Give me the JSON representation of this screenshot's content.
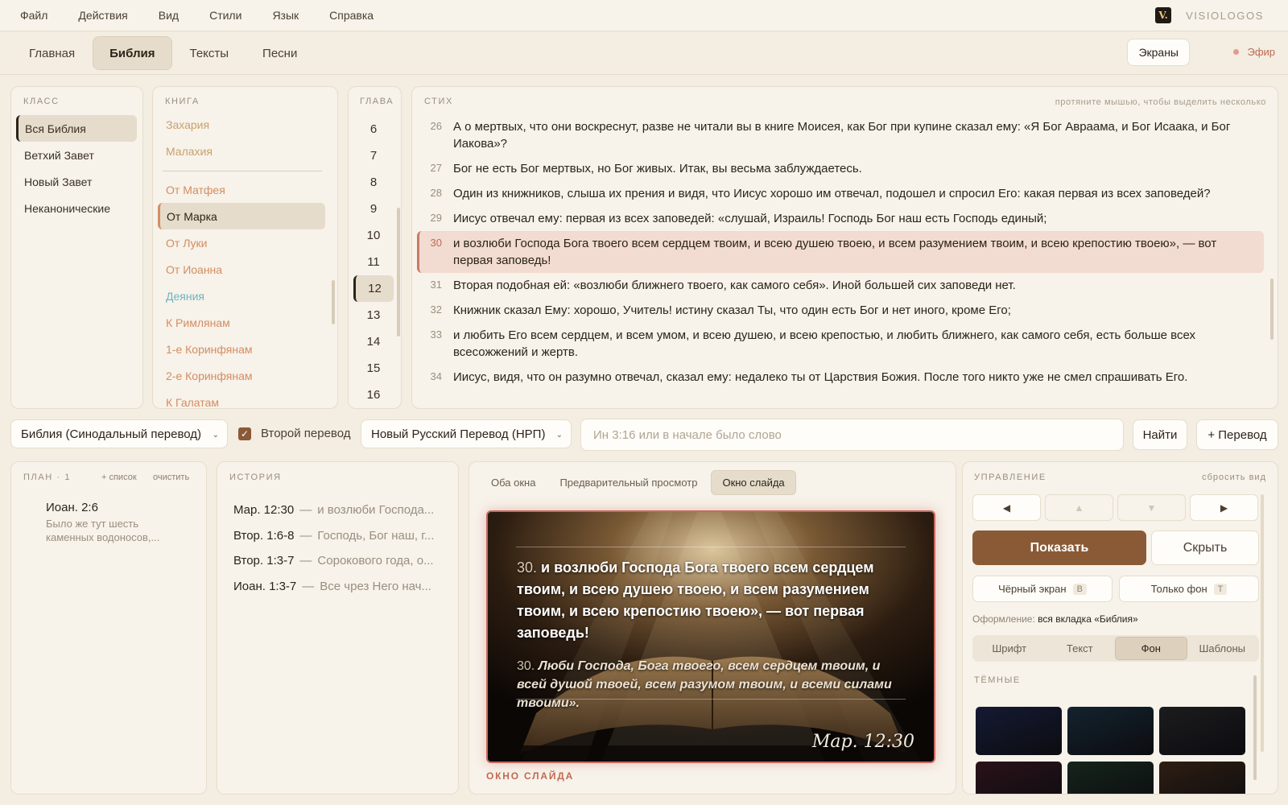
{
  "menu": [
    "Файл",
    "Действия",
    "Вид",
    "Стили",
    "Язык",
    "Справка"
  ],
  "brand": {
    "logo": "V.",
    "name": "VISIOLOGOS"
  },
  "tabs": [
    "Главная",
    "Библия",
    "Тексты",
    "Песни"
  ],
  "active_tab": "Библия",
  "screens_label": "Экраны",
  "air_label": "Эфир",
  "class_panel": {
    "label": "КЛАСС",
    "items": [
      "Вся Библия",
      "Ветхий Завет",
      "Новый Завет",
      "Неканонические"
    ],
    "active": "Вся Библия"
  },
  "book_panel": {
    "label": "КНИГА",
    "ot_items": [
      "Захария",
      "Малахия"
    ],
    "nt_items": [
      "От Матфея",
      "От Марка",
      "От Луки",
      "От Иоанна",
      "Деяния",
      "К Римлянам",
      "1-е Коринфянам",
      "2-е Коринфянам",
      "К Галатам"
    ],
    "active": "От Марка"
  },
  "chapter_panel": {
    "label": "ГЛАВА",
    "items": [
      "6",
      "7",
      "8",
      "9",
      "10",
      "11",
      "12",
      "13",
      "14",
      "15",
      "16"
    ],
    "active": "12"
  },
  "verse_panel": {
    "label": "СТИХ",
    "hint": "протяните мышью, чтобы выделить несколько",
    "verses": [
      {
        "num": "26",
        "text": "А о мертвых, что они воскреснут, разве не читали вы в книге Моисея, как Бог при купине сказал ему: «Я Бог Авраама, и Бог Исаака, и Бог Иакова»?"
      },
      {
        "num": "27",
        "text": "Бог не есть Бог мертвых, но Бог живых. Итак, вы весьма заблуждаетесь."
      },
      {
        "num": "28",
        "text": "Один из книжников, слыша их прения и видя, что Иисус хорошо им отвечал, подошел и спросил Его: какая первая из всех заповедей?"
      },
      {
        "num": "29",
        "text": "Иисус отвечал ему: первая из всех заповедей: «слушай, Израиль! Господь Бог наш есть Господь единый;"
      },
      {
        "num": "30",
        "text": "и возлюби Господа Бога твоего всем сердцем твоим, и всею душею твоею, и всем разумением твоим, и всею крепостию твоею», — вот первая заповедь!"
      },
      {
        "num": "31",
        "text": "Вторая подобная ей: «возлюби ближнего твоего, как самого себя». Иной большей сих заповеди нет."
      },
      {
        "num": "32",
        "text": "Книжник сказал Ему: хорошо, Учитель! истину сказал Ты, что один есть Бог и нет иного, кроме Его;"
      },
      {
        "num": "33",
        "text": "и любить Его всем сердцем, и всем умом, и всею душею, и всею крепостью, и любить ближнего, как самого себя, есть больше всех всесожжений и жертв."
      },
      {
        "num": "34",
        "text": "Иисус, видя, что он разумно отвечал, сказал ему: недалеко ты от Царствия Божия. После того никто уже не смел спрашивать Его."
      }
    ],
    "active": "30"
  },
  "search": {
    "translation": "Библия (Синодальный перевод)",
    "second_checkbox_label": "Второй перевод",
    "second_checked": true,
    "second_translation": "Новый Русский Перевод (НРП)",
    "placeholder": "Ин 3:16 или в начале было слово",
    "find_label": "Найти",
    "add_translation_label": "+ Перевод"
  },
  "plan": {
    "label": "ПЛАН · 1",
    "add_list": "+ список",
    "clear": "очистить",
    "items": [
      {
        "ref": "Иоан. 2:6",
        "snippet": "Было же тут шесть каменных водоносов,..."
      }
    ]
  },
  "history": {
    "label": "ИСТОРИЯ",
    "items": [
      {
        "ref": "Мар. 12:30",
        "text": "и возлюби Господа..."
      },
      {
        "ref": "Втор. 1:6-8",
        "text": "Господь, Бог наш, г..."
      },
      {
        "ref": "Втор. 1:3-7",
        "text": "Сорокового года, о..."
      },
      {
        "ref": "Иоан. 1:3-7",
        "text": "Все чрез Него нач..."
      }
    ]
  },
  "preview": {
    "tabs": [
      "Оба окна",
      "Предварительный просмотр",
      "Окно слайда"
    ],
    "active_tab": "Окно слайда",
    "slide": {
      "main_num": "30.",
      "main_text": "и возлюби Господа Бога твоего всем сердцем твоим, и всею душею твоею, и всем разумением твоим, и всею крепостию твоею», — вот первая заповедь!",
      "second_num": "30.",
      "second_text": "Люби Господа, Бога твоего, всем сердцем твоим, и всей душой твоей, всем разумом твоим, и всеми силами твоими».",
      "ref": "Мар. 12:30"
    },
    "caption": "ОКНО СЛАЙДА"
  },
  "control": {
    "label": "УПРАВЛЕНИЕ",
    "reset_view": "сбросить вид",
    "nav": [
      "◀",
      "▲",
      "▼",
      "▶"
    ],
    "show_label": "Показать",
    "hide_label": "Скрыть",
    "black_screen_label": "Чёрный экран",
    "black_screen_key": "B",
    "bg_only_label": "Только фон",
    "bg_only_key": "T",
    "design_prefix": "Оформление:",
    "design_value": "вся вкладка «Библия»",
    "style_tabs": [
      "Шрифт",
      "Текст",
      "Фон",
      "Шаблоны"
    ],
    "active_style_tab": "Фон",
    "dark_label": "ТЁМНЫЕ",
    "swatches": [
      "#141a33",
      "#13232e",
      "#1c1c1e",
      "#2a1219",
      "#15241b",
      "#2e1e12"
    ]
  },
  "colors": {
    "accent_brown": "#8a5a36",
    "active_verse_bg": "#f2dbd0",
    "live_red": "#c06a52"
  }
}
